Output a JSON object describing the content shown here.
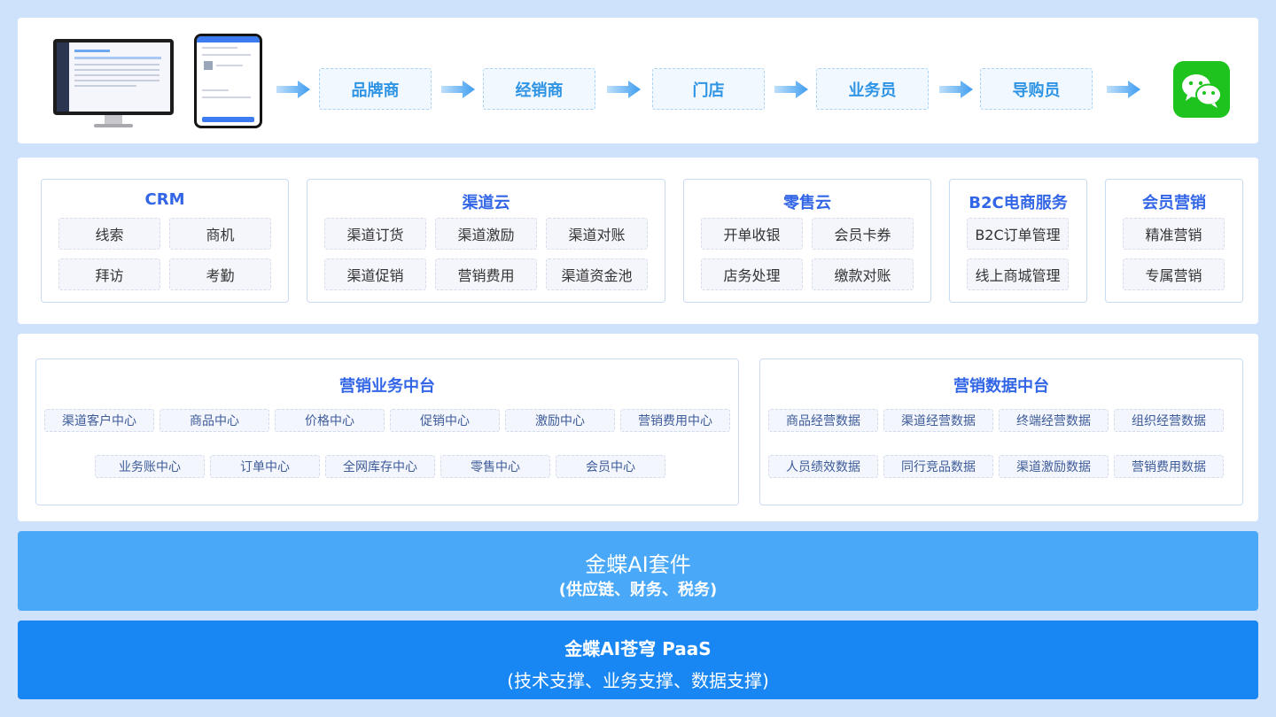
{
  "channel_flow": {
    "nodes": [
      "品牌商",
      "经销商",
      "门店",
      "业务员",
      "导购员"
    ],
    "arrow_color": "#4aa3f0",
    "end_icon": "wechat-icon",
    "devices": [
      "desktop-monitor-icon",
      "mobile-phone-icon"
    ]
  },
  "apps": [
    {
      "title": "CRM",
      "items": [
        "线索",
        "商机",
        "拜访",
        "考勤"
      ]
    },
    {
      "title": "渠道云",
      "items": [
        "渠道订货",
        "渠道激励",
        "渠道对账",
        "渠道促销",
        "营销费用",
        "渠道资金池"
      ]
    },
    {
      "title": "零售云",
      "items": [
        "开单收银",
        "会员卡券",
        "店务处理",
        "缴款对账"
      ]
    },
    {
      "title": "B2C电商服务",
      "items": [
        "B2C订单管理",
        "线上商城管理"
      ]
    },
    {
      "title": "会员营销",
      "items": [
        "精准营销",
        "专属营销"
      ]
    }
  ],
  "business_platform": {
    "title": "营销业务中台",
    "items": [
      "渠道客户中心",
      "商品中心",
      "价格中心",
      "促销中心",
      "激励中心",
      "营销费用中心",
      "业务账中心",
      "订单中心",
      "全网库存中心",
      "零售中心",
      "会员中心"
    ]
  },
  "data_platform": {
    "title": "营销数据中台",
    "items": [
      "商品经营数据",
      "渠道经营数据",
      "终端经营数据",
      "组织经营数据",
      "人员绩效数据",
      "同行竞品数据",
      "渠道激励数据",
      "营销费用数据"
    ]
  },
  "ai_suite": {
    "title": "金蝶AI套件",
    "subtitle": "(供应链、财务、税务)"
  },
  "paas": {
    "title": "金蝶AI苍穹 PaaS",
    "subtitle": "(技术支撑、业务支撑、数据支撑)"
  },
  "colors": {
    "background": "#cfe2fb",
    "title_blue": "#3366e6",
    "flow_text": "#2f94e4",
    "suite_bar": "#4aa8f8",
    "paas_bar": "#1887f4",
    "wechat_green": "#1ec31e"
  }
}
